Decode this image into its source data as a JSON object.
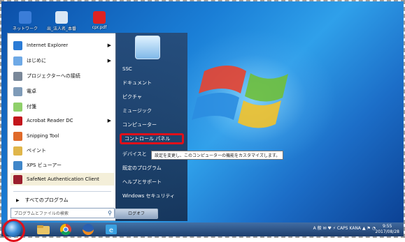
{
  "desktop": {
    "icons": [
      {
        "label": "ネットワーク",
        "color": "#3b7dd8"
      },
      {
        "label": "出_法人名_本番",
        "color": "#d9e7f5"
      },
      {
        "label": "cpr.pdf",
        "color": "#d22"
      }
    ]
  },
  "start_menu": {
    "left_items": [
      {
        "label": "Internet Explorer",
        "icon": "ie-icon",
        "has_arrow": true,
        "color": "#2a7bd6"
      },
      {
        "label": "はじめに",
        "icon": "getting-started-icon",
        "has_arrow": true,
        "color": "#6ea9e6"
      },
      {
        "label": "プロジェクターへの接続",
        "icon": "projector-icon",
        "has_arrow": false,
        "color": "#7a8899"
      },
      {
        "label": "電卓",
        "icon": "calculator-icon",
        "has_arrow": false,
        "color": "#7f9bb8"
      },
      {
        "label": "付箋",
        "icon": "sticky-notes-icon",
        "has_arrow": false,
        "color": "#8fd06a"
      },
      {
        "label": "Acrobat Reader DC",
        "icon": "acrobat-icon",
        "has_arrow": true,
        "color": "#c3161c"
      },
      {
        "label": "Snipping Tool",
        "icon": "scissors-icon",
        "has_arrow": false,
        "color": "#e06a2a"
      },
      {
        "label": "ペイント",
        "icon": "paint-icon",
        "has_arrow": false,
        "color": "#e0b64a"
      },
      {
        "label": "XPS ビューアー",
        "icon": "xps-icon",
        "has_arrow": false,
        "color": "#3f86c9"
      },
      {
        "label": "SafeNet Authentication Client",
        "icon": "safenet-icon",
        "has_arrow": false,
        "color": "#9b1f2d"
      }
    ],
    "all_programs": "すべてのプログラム",
    "search_placeholder": "プログラムとファイルの検索",
    "right_items": [
      {
        "label": "SSC"
      },
      {
        "label": "ドキュメント"
      },
      {
        "label": "ピクチャ"
      },
      {
        "label": "ミュージック"
      },
      {
        "label": "コンピューター"
      },
      {
        "label": "コントロール パネル"
      },
      {
        "label": "デバイスと"
      },
      {
        "label": "既定のプログラム"
      },
      {
        "label": "ヘルプとサポート"
      },
      {
        "label": "Windows セキュリティ"
      }
    ],
    "shutdown": "ログオフ",
    "tooltip": "設定を変更し、このコンピューターの機能をカスタマイズします。"
  },
  "taskbar": {
    "tray_text": "A 般 ✉ ♥ ⚡ CAPS KANA ▲ ⚑ ◔",
    "time": "9:55",
    "date": "2017/08/28"
  },
  "colors": {
    "highlight": "#e0101a",
    "selected_item_bg": "#f4efd9"
  }
}
